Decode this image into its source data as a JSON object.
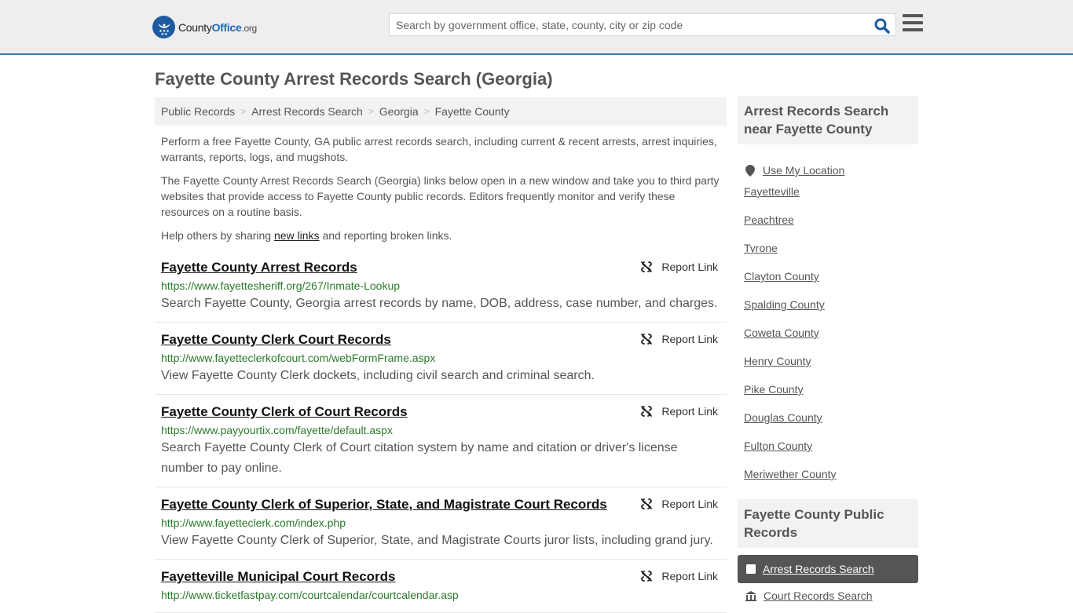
{
  "header": {
    "logo": {
      "name_part1": "County",
      "name_part2": "Office",
      "tld": ".org"
    },
    "search": {
      "placeholder": "Search by government office, state, county, city or zip code",
      "value": ""
    },
    "search_icon": "search-icon",
    "menu_icon": "hamburger-menu-icon"
  },
  "page": {
    "title": "Fayette County Arrest Records Search (Georgia)"
  },
  "breadcrumb": [
    {
      "label": "Public Records"
    },
    {
      "label": "Arrest Records Search"
    },
    {
      "label": "Georgia"
    },
    {
      "label": "Fayette County"
    }
  ],
  "breadcrumb_separator": ">",
  "intro": {
    "p1": "Perform a free Fayette County, GA public arrest records search, including current & recent arrests, arrest inquiries, warrants, reports, logs, and mugshots.",
    "p2": "The Fayette County Arrest Records Search (Georgia) links below open in a new window and take you to third party websites that provide access to Fayette County public records. Editors frequently monitor and verify these resources on a routine basis.",
    "p3_before": "Help others by sharing ",
    "p3_link": "new links",
    "p3_after": " and reporting broken links."
  },
  "report_label": "Report Link",
  "results": [
    {
      "title": "Fayette County Arrest Records",
      "url": "https://www.fayettesheriff.org/267/Inmate-Lookup",
      "description": "Search Fayette County, Georgia arrest records by name, DOB, address, case number, and charges."
    },
    {
      "title": "Fayette County Clerk Court Records",
      "url": "http://www.fayetteclerkofcourt.com/webFormFrame.aspx",
      "description": "View Fayette County Clerk dockets, including civil search and criminal search."
    },
    {
      "title": "Fayette County Clerk of Court Records",
      "url": "https://www.payyourtix.com/fayette/default.aspx",
      "description": "Search Fayette County Clerk of Court citation system by name and citation or driver's license number to pay online."
    },
    {
      "title": "Fayette County Clerk of Superior, State, and Magistrate Court Records",
      "url": "http://www.fayetteclerk.com/index.php",
      "description": "View Fayette County Clerk of Superior, State, and Magistrate Courts juror lists, including grand jury."
    },
    {
      "title": "Fayetteville Municipal Court Records",
      "url": "http://www.ticketfastpay.com/courtcalendar/courtcalendar.asp",
      "description": ""
    }
  ],
  "sidebar": {
    "nearby_heading": "Arrest Records Search near Fayette County",
    "use_location": "Use My Location",
    "nearby": [
      "Fayetteville",
      "Peachtree",
      "Tyrone",
      "Clayton County",
      "Spalding County",
      "Coweta County",
      "Henry County",
      "Pike County",
      "Douglas County",
      "Fulton County",
      "Meriwether County"
    ],
    "public_records_heading": "Fayette County Public Records",
    "active_item": "Arrest Records Search",
    "next_item": "Court Records Search"
  },
  "colors": {
    "brand_blue": "#1e5aa0",
    "header_border": "#3a7cae",
    "url_green": "#2b7a2b",
    "active_bg": "#555555"
  }
}
